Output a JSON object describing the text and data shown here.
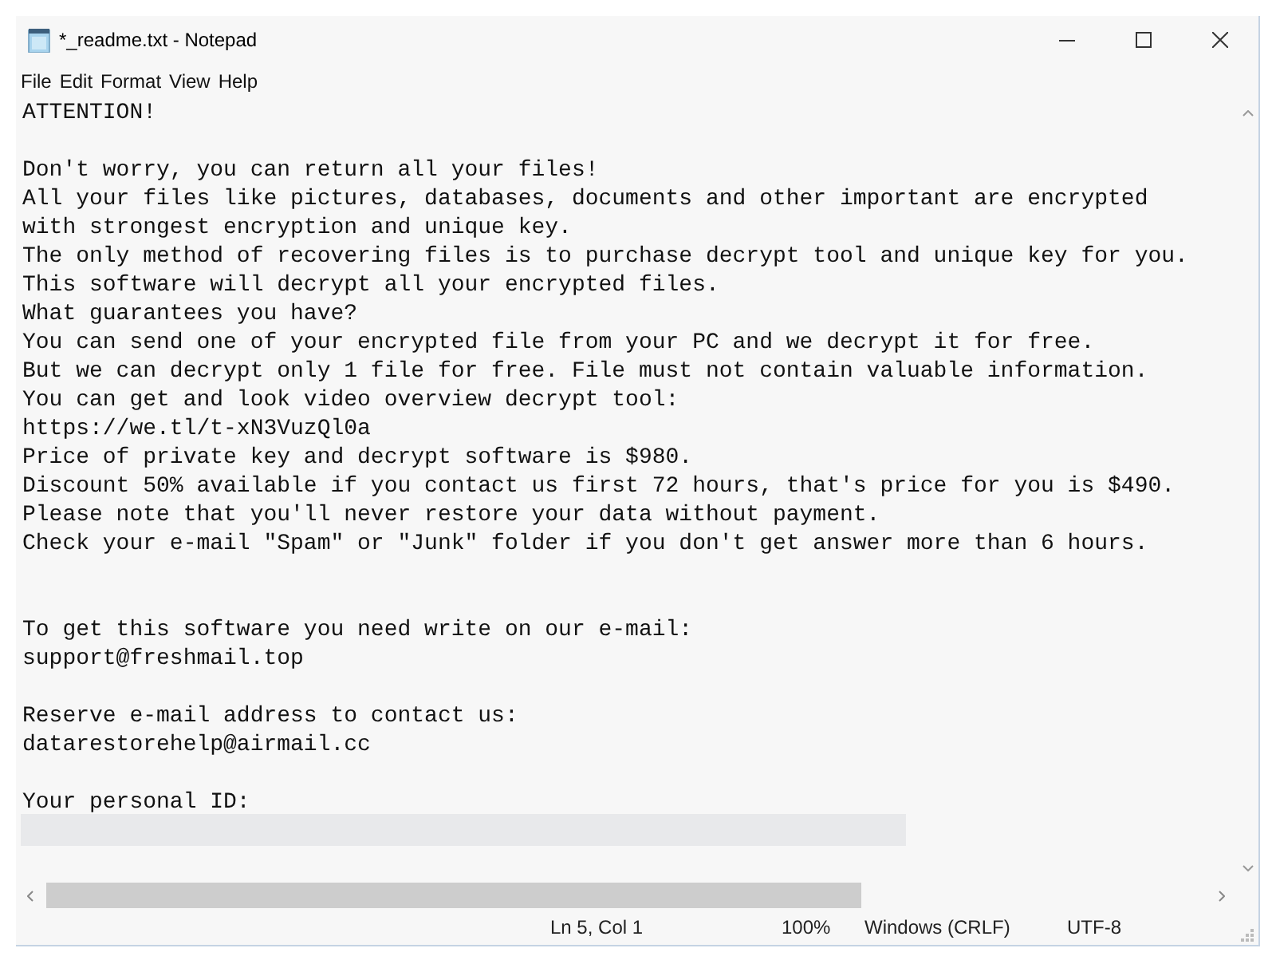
{
  "window": {
    "title": "*_readme.txt - Notepad"
  },
  "menu": [
    "File",
    "Edit",
    "Format",
    "View",
    "Help"
  ],
  "document": {
    "lines": [
      {
        "kind": "text",
        "text": "ATTENTION!"
      },
      {
        "kind": "blank"
      },
      {
        "kind": "text",
        "text": "Don't worry, you can return all your files!"
      },
      {
        "kind": "text",
        "text": "All your files like pictures, databases, documents and other important are encrypted"
      },
      {
        "kind": "text",
        "text": "with strongest encryption and unique key."
      },
      {
        "kind": "text",
        "text": "The only method of recovering files is to purchase decrypt tool and unique key for you."
      },
      {
        "kind": "text",
        "text": "This software will decrypt all your encrypted files."
      },
      {
        "kind": "text",
        "text": "What guarantees you have?"
      },
      {
        "kind": "text",
        "text": "You can send one of your encrypted file from your PC and we decrypt it for free."
      },
      {
        "kind": "text",
        "text": "But we can decrypt only 1 file for free. File must not contain valuable information."
      },
      {
        "kind": "text",
        "text": "You can get and look video overview decrypt tool:"
      },
      {
        "kind": "text",
        "text": "https://we.tl/t-xN3VuzQl0a"
      },
      {
        "kind": "text",
        "text": "Price of private key and decrypt software is $980."
      },
      {
        "kind": "text",
        "text": "Discount 50% available if you contact us first 72 hours, that's price for you is $490."
      },
      {
        "kind": "text",
        "text": "Please note that you'll never restore your data without payment."
      },
      {
        "kind": "text",
        "text": "Check your e-mail \"Spam\" or \"Junk\" folder if you don't get answer more than 6 hours."
      },
      {
        "kind": "blank"
      },
      {
        "kind": "blank"
      },
      {
        "kind": "text",
        "text": "To get this software you need write on our e-mail:"
      },
      {
        "kind": "text",
        "text": "support@freshmail.top"
      },
      {
        "kind": "blank"
      },
      {
        "kind": "text",
        "text": "Reserve e-mail address to contact us:"
      },
      {
        "kind": "text",
        "text": "datarestorehelp@airmail.cc"
      },
      {
        "kind": "blank"
      },
      {
        "kind": "text",
        "text": "Your personal ID:"
      },
      {
        "kind": "redacted"
      }
    ]
  },
  "status_bar": {
    "position": "Ln 5, Col 1",
    "zoom": "100%",
    "line_ending": "Windows (CRLF)",
    "encoding": "UTF-8"
  }
}
